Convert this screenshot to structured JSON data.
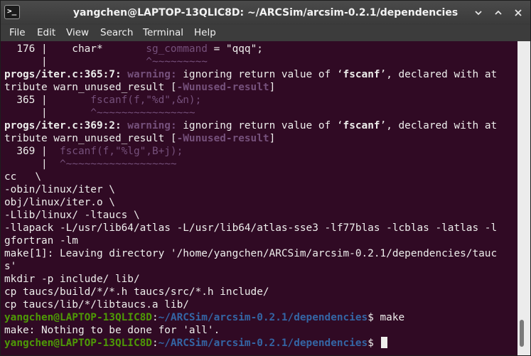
{
  "window": {
    "title": "yangchen@LAPTOP-13QLIC8D: ~/ARCSim/arcsim-0.2.1/dependencies",
    "icon_label": ">_",
    "controls": [
      "minimize-icon",
      "maximize-icon",
      "close-icon"
    ]
  },
  "menu": {
    "file": "File",
    "edit": "Edit",
    "view": "View",
    "search": "Search",
    "terminal": "Terminal",
    "help": "Help"
  },
  "colors": {
    "background": "#300a24",
    "text": "#eeeeec",
    "warning": "#75507b",
    "prompt_user": "#4e9a06",
    "prompt_path": "#3465a4",
    "titlebar": "#3e3e3e",
    "menubar": "#3c3c3c"
  },
  "terminal": {
    "l1": {
      "prefix": "  176 |    char*       ",
      "code": "sg_command",
      "suffix": " = \"qqq\";"
    },
    "l2": {
      "prefix": "      |                ",
      "marker": "^~~~~~~~~~"
    },
    "l3": {
      "loc": "progs/iter.c:365:7:",
      "warn": "warning:",
      "msg1": " ignoring return value of ‘",
      "fn": "fscanf",
      "msg2": "’, declared with at"
    },
    "l4": {
      "text": "tribute warn_unused_result [",
      "flag": "-Wunused-result",
      "end": "]"
    },
    "l5": {
      "prefix": "  365 |       ",
      "code": "fscanf(f,\"%d\",&n);"
    },
    "l6": {
      "prefix": "      |       ",
      "marker": "^~~~~~~~~~~~~~~~~"
    },
    "l7": {
      "loc": "progs/iter.c:369:2:",
      "warn": "warning:",
      "msg1": " ignoring return value of ‘",
      "fn": "fscanf",
      "msg2": "’, declared with at"
    },
    "l8": {
      "text": "tribute warn_unused_result [",
      "flag": "-Wunused-result",
      "end": "]"
    },
    "l9": {
      "prefix": "  369 |  ",
      "code": "fscanf(f,\"%lg\",B+j);"
    },
    "l10": {
      "prefix": "      |  ",
      "marker": "^~~~~~~~~~~~~~~~~~~"
    },
    "l11": "cc   \\",
    "l12": "-obin/linux/iter \\",
    "l13": "obj/linux/iter.o \\",
    "l14": "-Llib/linux/ -ltaucs \\",
    "l15": "-llapack -L/usr/lib64/atlas -L/usr/lib64/atlas-sse3 -lf77blas -lcblas -latlas -l",
    "l16": "gfortran -lm",
    "l17": "make[1]: Leaving directory '/home/yangchen/ARCSim/arcsim-0.2.1/dependencies/tauc",
    "l18": "s'",
    "l19": "mkdir -p include/ lib/",
    "l20": "cp taucs/build/*/*.h taucs/src/*.h include/",
    "l21": "cp taucs/lib/*/libtaucs.a lib/",
    "l22": {
      "user": "yangchen@LAPTOP-13QLIC8D",
      "colon": ":",
      "path": "~/ARCSim/arcsim-0.2.1/dependencies",
      "sym": "$ ",
      "cmd": "make"
    },
    "l23": "make: Nothing to be done for 'all'.",
    "l24": {
      "user": "yangchen@LAPTOP-13QLIC8D",
      "colon": ":",
      "path": "~/ARCSim/arcsim-0.2.1/dependencies",
      "sym": "$ "
    }
  }
}
